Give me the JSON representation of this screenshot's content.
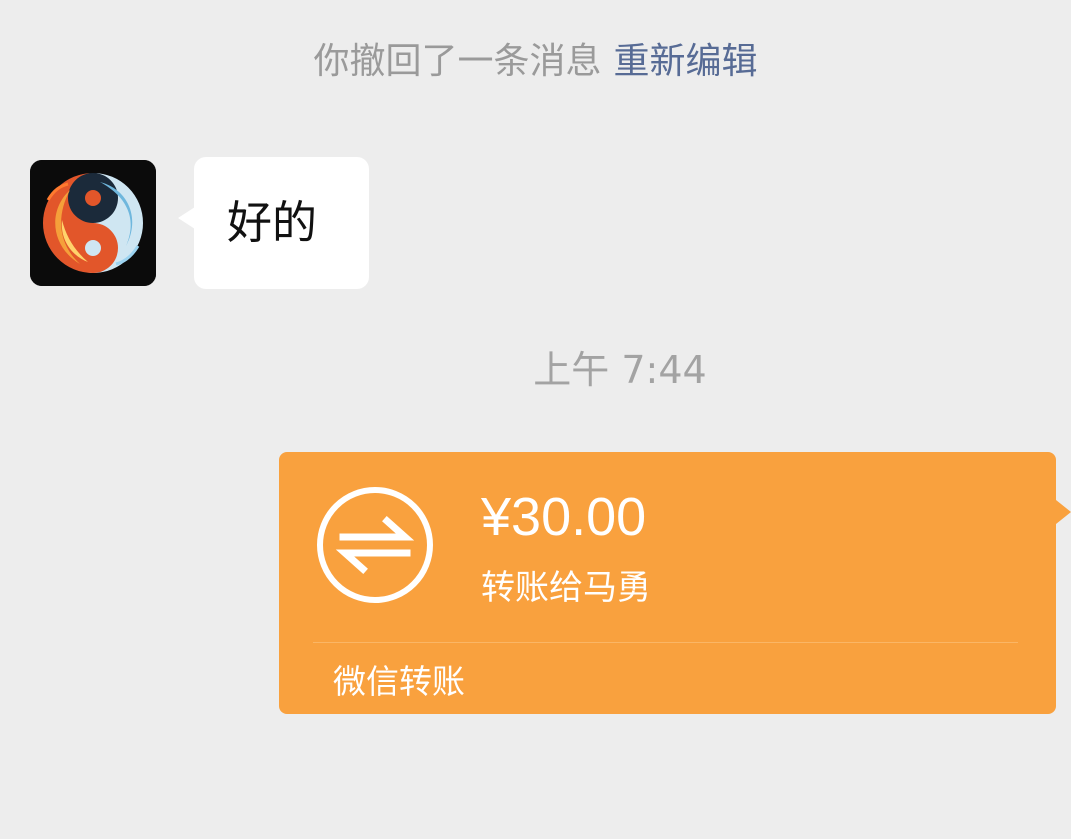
{
  "system_notice": {
    "recall_text": "你撤回了一条消息",
    "reedit_label": "重新编辑"
  },
  "incoming_message": {
    "avatar_icon": "flame-water-swirl-avatar",
    "text": "好的"
  },
  "timestamp": "上午 7:44",
  "transfer": {
    "icon": "transfer-arrows-icon",
    "amount": "¥30.00",
    "recipient_label": "转账给马勇",
    "service_label": "微信转账",
    "color": "#f9a13e"
  },
  "colors": {
    "background": "#ededed",
    "link": "#576b95",
    "muted_text": "#9a9a9a"
  }
}
